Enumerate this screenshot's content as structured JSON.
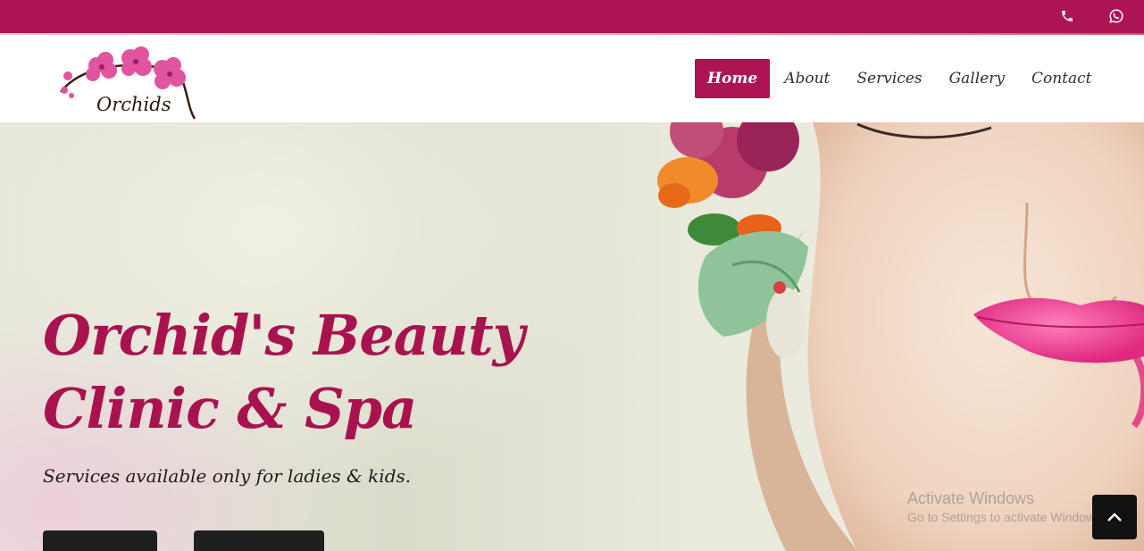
{
  "colors": {
    "brand": "#ac1453",
    "text_dark": "#1e1a1b",
    "button_dark": "#1f1f1f"
  },
  "topbar": {
    "icons": [
      "phone-icon",
      "whatsapp-icon"
    ]
  },
  "logo": {
    "text": "Orchids"
  },
  "nav": {
    "items": [
      {
        "label": "Home",
        "active": true
      },
      {
        "label": "About",
        "active": false
      },
      {
        "label": "Services",
        "active": false
      },
      {
        "label": "Gallery",
        "active": false
      },
      {
        "label": "Contact",
        "active": false
      }
    ]
  },
  "hero": {
    "title_line1": "Orchid's Beauty",
    "title_line2": "Clinic & Spa",
    "subtitle": "Services available only for ladies & kids."
  },
  "watermark": {
    "line1": "Activate Windows",
    "line2": "Go to Settings to activate Windows."
  },
  "scroll_top": {
    "icon": "chevron-up-icon"
  }
}
